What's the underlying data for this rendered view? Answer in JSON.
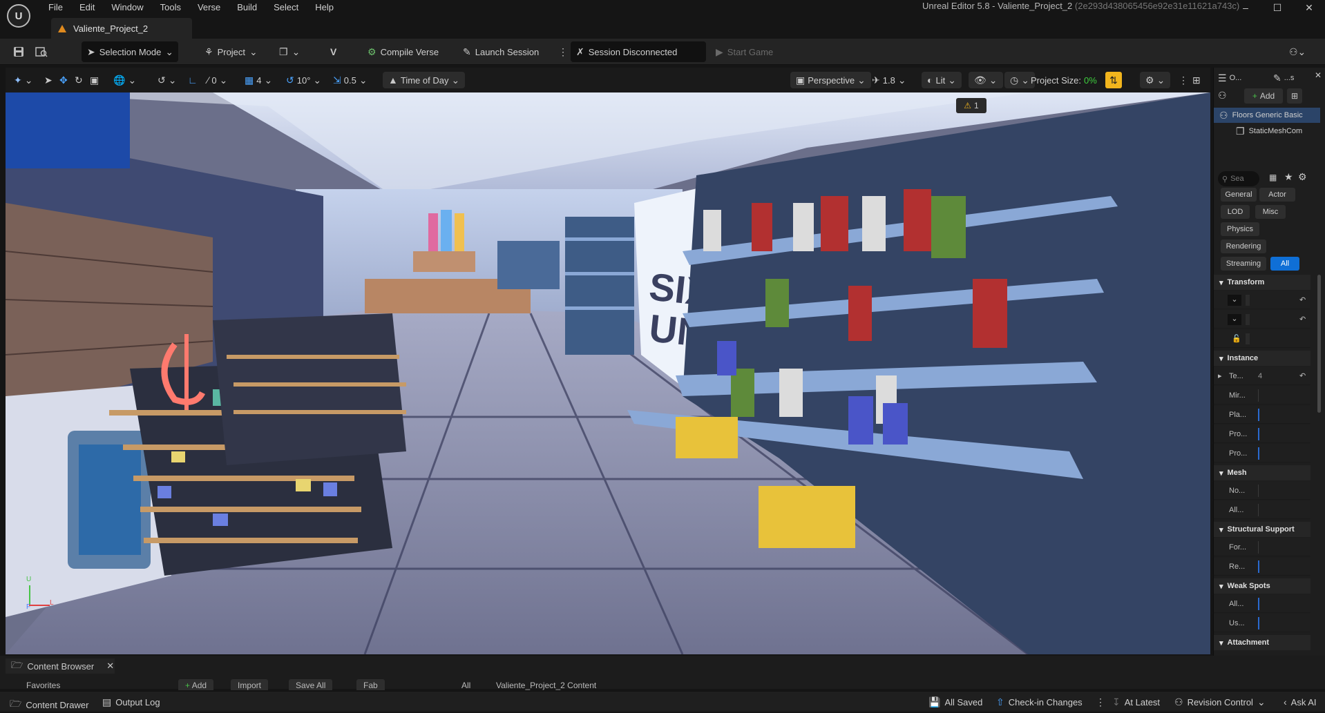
{
  "menu": [
    "File",
    "Edit",
    "Window",
    "Tools",
    "Verse",
    "Build",
    "Select",
    "Help"
  ],
  "project_tab": "Valiente_Project_2",
  "window_title": {
    "main": "Unreal Editor 5.8 - Valiente_Project_2",
    "hash": "(2e293d438065456e92e31e11621a743c)"
  },
  "toolbar": {
    "selection_mode": "Selection Mode",
    "project": "Project",
    "compile_verse": "Compile Verse",
    "launch_session": "Launch Session",
    "session_status": "Session Disconnected",
    "start_game": "Start Game"
  },
  "viewport_toolbar": {
    "snap_rotate": "0",
    "grid": "4",
    "rotation": "10°",
    "scale": "0.5",
    "time_of_day": "Time of Day",
    "perspective": "Perspective",
    "camera_speed": "1.8",
    "lit": "Lit",
    "project_size_label": "Project Size:",
    "project_size_value": "0%",
    "warnings": "1"
  },
  "viewport_scene": {
    "sign_line1": "SIX FO",
    "sign_line2": "UND"
  },
  "axis": {
    "x": "L",
    "y": "U",
    "z": "F"
  },
  "right_panel": {
    "outliner_tab": "O...",
    "details_tab": "...s",
    "add_label": "Add",
    "tree": [
      "Floors Generic Basic",
      "StaticMeshCom"
    ],
    "search_placeholder": "Sea",
    "filters": [
      "General",
      "Actor",
      "LOD",
      "Misc",
      "Physics",
      "Rendering",
      "Streaming",
      "All"
    ],
    "sections": [
      {
        "title": "Transform",
        "rows": [
          "",
          "",
          ""
        ]
      },
      {
        "title": "Instance",
        "rows": [
          "Te...",
          "Mir...",
          "Pla...",
          "Pro...",
          "Pro..."
        ]
      },
      {
        "title": "Mesh",
        "rows": [
          "No...",
          "All..."
        ]
      },
      {
        "title": "Structural Support",
        "rows": [
          "For...",
          "Re..."
        ]
      },
      {
        "title": "Weak Spots",
        "rows": [
          "All...",
          "Us..."
        ]
      },
      {
        "title": "Attachment",
        "rows": []
      }
    ],
    "instance_value": "4"
  },
  "content_browser": {
    "tab": "Content Browser",
    "add": "Add",
    "import": "Import",
    "save_all": "Save All",
    "fab": "Fab",
    "favorites": "Favorites",
    "path": [
      "All",
      "Valiente_Project_2 Content"
    ]
  },
  "status_bar": {
    "content_drawer": "Content Drawer",
    "output_log": "Output Log",
    "all_saved": "All Saved",
    "check_in": "Check-in Changes",
    "at_latest": "At Latest",
    "revision_control": "Revision Control",
    "ask_ai": "Ask AI"
  },
  "colors": {
    "accent_blue": "#0f6fd6",
    "warning_yellow": "#f2b51d",
    "project_size_green": "#3ecf3e"
  }
}
